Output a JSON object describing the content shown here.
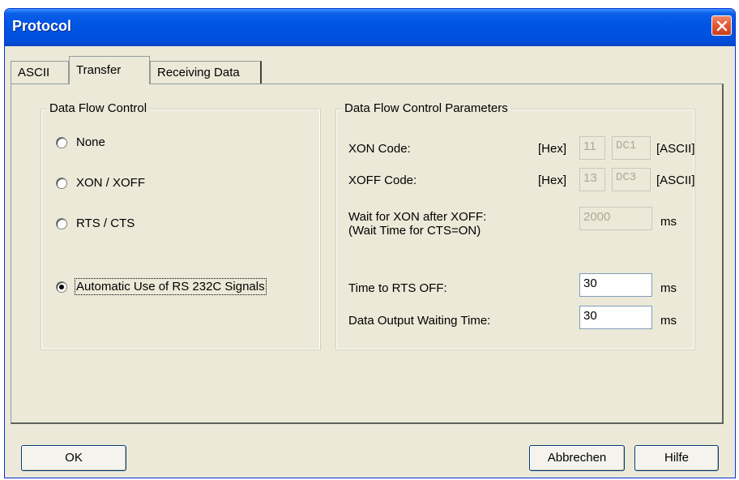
{
  "window": {
    "title": "Protocol"
  },
  "tabs": [
    {
      "label": "ASCII"
    },
    {
      "label": "Transfer"
    },
    {
      "label": "Receiving Data"
    }
  ],
  "flow_control": {
    "legend": "Data Flow Control",
    "options": [
      {
        "label": "None",
        "checked": false
      },
      {
        "label": "XON / XOFF",
        "checked": false
      },
      {
        "label": "RTS / CTS",
        "checked": false
      },
      {
        "label": "Automatic Use of RS 232C Signals",
        "checked": true
      }
    ]
  },
  "params": {
    "legend": "Data Flow Control Parameters",
    "xon": {
      "label": "XON Code:",
      "hex_label": "[Hex]",
      "hex_value": "11",
      "ascii_value": "DC1",
      "ascii_label": "[ASCII]"
    },
    "xoff": {
      "label": "XOFF Code:",
      "hex_label": "[Hex]",
      "hex_value": "13",
      "ascii_value": "DC3",
      "ascii_label": "[ASCII]"
    },
    "wait_xon": {
      "label_line1": "Wait for XON after XOFF:",
      "label_line2": "(Wait Time for CTS=ON)",
      "value": "2000",
      "unit": "ms"
    },
    "rts_off": {
      "label": "Time to RTS OFF:",
      "value": "30",
      "unit": "ms"
    },
    "output_wait": {
      "label": "Data Output Waiting Time:",
      "value": "30",
      "unit": "ms"
    }
  },
  "buttons": {
    "ok": "OK",
    "cancel": "Abbrechen",
    "help": "Hilfe"
  }
}
